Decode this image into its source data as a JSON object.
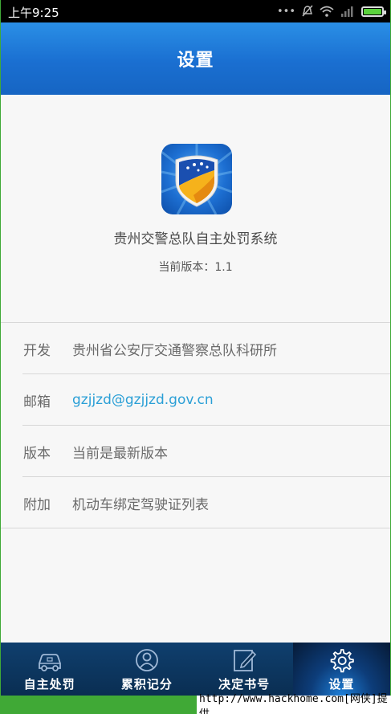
{
  "status_bar": {
    "time": "上午9:25",
    "icons": [
      "more-dots-icon",
      "mute-icon",
      "wifi-icon",
      "signal-icon",
      "battery-icon"
    ]
  },
  "header": {
    "title": "设置"
  },
  "about": {
    "app_name": "贵州交警总队自主处罚系统",
    "version": "当前版本：1.1"
  },
  "info_rows": [
    {
      "label": "开发",
      "value": "贵州省公安厅交通警察总队科研所"
    },
    {
      "label": "邮箱",
      "value": "gzjjzd@gzjjzd.gov.cn"
    },
    {
      "label": "版本",
      "value": "当前是最新版本"
    },
    {
      "label": "附加",
      "value": "机动车绑定驾驶证列表"
    }
  ],
  "bottom_nav": [
    {
      "label": "自主处罚",
      "icon": "car-icon",
      "active": false
    },
    {
      "label": "累积记分",
      "icon": "user-icon",
      "active": false
    },
    {
      "label": "决定书号",
      "icon": "edit-document-icon",
      "active": false
    },
    {
      "label": "设置",
      "icon": "gear-icon",
      "active": true
    }
  ],
  "watermark": "http://www.hackhome.com[网侠]提供",
  "colors": {
    "header_blue": "#1a6fd1",
    "link_blue": "#2a9fd6",
    "nav_bg": "#0a2e52",
    "border_green": "#40a936"
  }
}
